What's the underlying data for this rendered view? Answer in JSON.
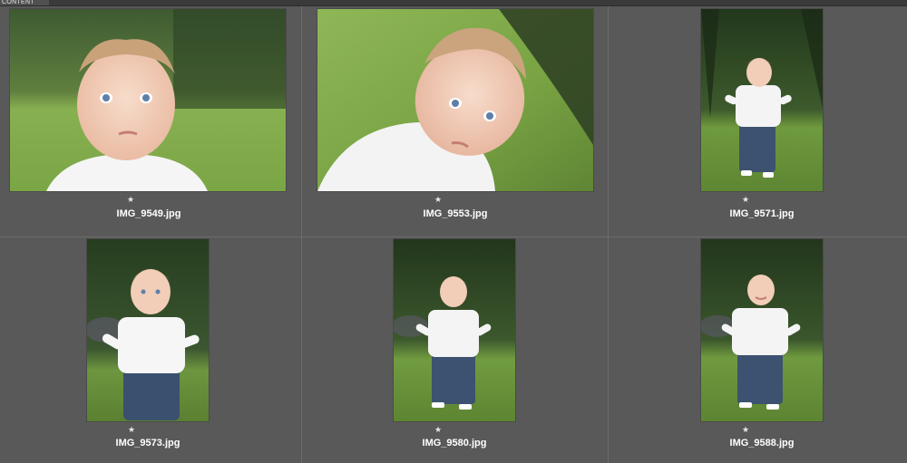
{
  "panel": {
    "title": "CONTENT"
  },
  "thumbnails": [
    {
      "filename": "IMG_9549.jpg",
      "rating": "★",
      "subject": "baby-closeup",
      "orientation": "landscape"
    },
    {
      "filename": "IMG_9553.jpg",
      "rating": "★",
      "subject": "baby-closeup-tilted",
      "orientation": "landscape"
    },
    {
      "filename": "IMG_9571.jpg",
      "rating": "★",
      "subject": "toddler-standing",
      "orientation": "portrait"
    },
    {
      "filename": "IMG_9573.jpg",
      "rating": "★",
      "subject": "toddler-standing-near",
      "orientation": "portrait"
    },
    {
      "filename": "IMG_9580.jpg",
      "rating": "★",
      "subject": "toddler-standing",
      "orientation": "portrait"
    },
    {
      "filename": "IMG_9588.jpg",
      "rating": "★",
      "subject": "toddler-standing-smiling",
      "orientation": "portrait"
    }
  ],
  "colors": {
    "panel_bg": "#595959",
    "grass": "#7fa84a",
    "foliage": "#2f4a22",
    "skin": "#f2cdb8",
    "shirt": "#f4f4f4",
    "jeans": "#3d5270"
  }
}
